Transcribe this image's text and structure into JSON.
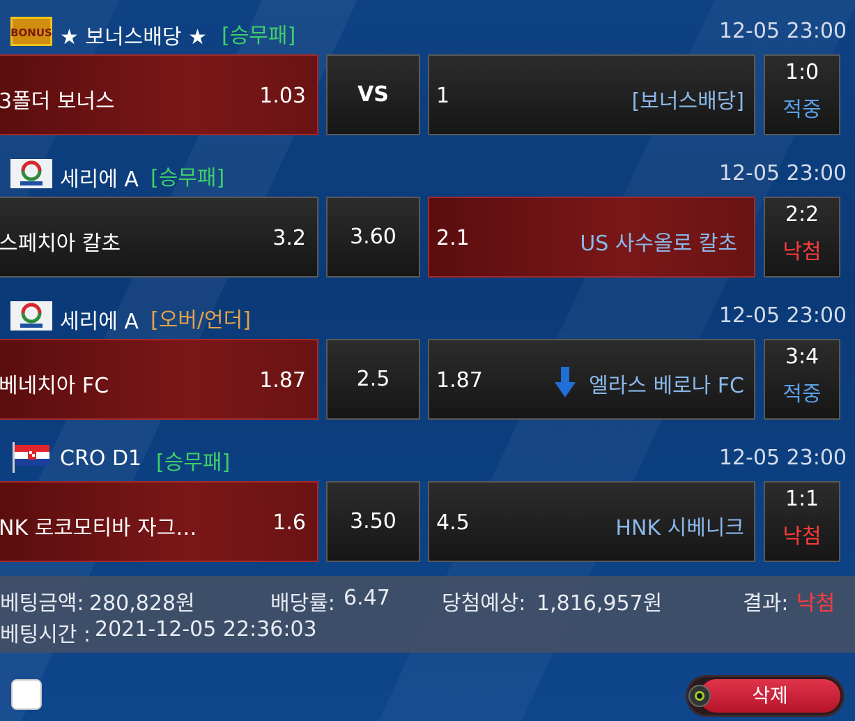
{
  "colors": {
    "type_win_draw_loss": "#3ecf6a",
    "type_over_under": "#e3a347",
    "status_hit": "#5aa0e8",
    "status_miss": "#ff3b3b"
  },
  "matches": [
    {
      "league_icon": "bonus-badge-icon",
      "league_name": "★ 보너스배당 ★",
      "bet_type": "[승무패]",
      "bet_type_kind": "win_draw_loss",
      "kickoff": "12-05 23:00",
      "home_team": "3폴더 보너스",
      "home_odds": "1.03",
      "middle": "VS",
      "away_odds": "1",
      "away_team": "[보너스배당]",
      "score": "1:0",
      "status": "적중",
      "status_kind": "hit",
      "selected": "home"
    },
    {
      "league_icon": "serie-a-logo-icon",
      "league_name": "세리에 A",
      "bet_type": "[승무패]",
      "bet_type_kind": "win_draw_loss",
      "kickoff": "12-05 23:00",
      "home_team": "스페치아 칼초",
      "home_odds": "3.2",
      "middle": "3.60",
      "away_odds": "2.1",
      "away_team": "US 사수올로 칼초",
      "score": "2:2",
      "status": "낙첨",
      "status_kind": "miss",
      "selected": "away"
    },
    {
      "league_icon": "serie-a-logo-icon",
      "league_name": "세리에 A",
      "bet_type": "[오버/언더]",
      "bet_type_kind": "over_under",
      "kickoff": "12-05 23:00",
      "home_team": "베네치아 FC",
      "home_odds": "1.87",
      "middle": "2.5",
      "away_odds": "1.87",
      "away_team": "엘라스 베로나 FC",
      "score": "3:4",
      "status": "적중",
      "status_kind": "hit",
      "selected": "home"
    },
    {
      "league_icon": "croatia-flag-icon",
      "league_name": "CRO D1",
      "bet_type": "[승무패]",
      "bet_type_kind": "win_draw_loss",
      "kickoff": "12-05 23:00",
      "home_team": "NK 로코모티바 자그…",
      "home_odds": "1.6",
      "middle": "3.50",
      "away_odds": "4.5",
      "away_team": "HNK 시베니크",
      "score": "1:1",
      "status": "낙첨",
      "status_kind": "miss",
      "selected": "home"
    }
  ],
  "summary": {
    "bet_amount_label": "베팅금액:",
    "bet_amount": "280,828원",
    "odds_label": "배당률:",
    "odds": "6.47",
    "expected_label": "당첨예상:",
    "expected": "1,816,957원",
    "result_label": "결과:",
    "result": "낙첨",
    "time_label": "베팅시간 :",
    "time": "2021-12-05 22:36:03"
  },
  "delete_label": "삭제"
}
